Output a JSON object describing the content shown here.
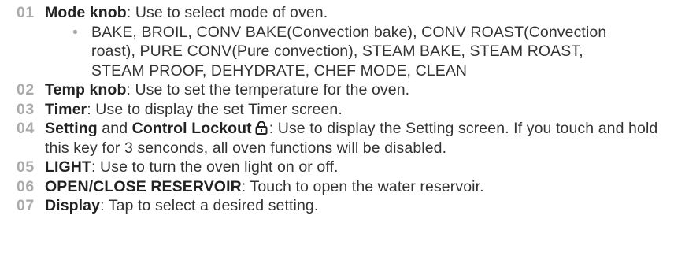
{
  "items": [
    {
      "num": "01",
      "label": "Mode knob",
      "text": ": Use to select mode of oven.",
      "sub_bullet": "•",
      "sub": "BAKE, BROIL, CONV BAKE(Convection bake), CONV ROAST(Convection roast), PURE CONV(Pure convection), STEAM BAKE, STEAM ROAST, STEAM PROOF, DEHYDRATE, CHEF MODE, CLEAN"
    },
    {
      "num": "02",
      "label": "Temp knob",
      "text": ": Use to set the temperature for the oven."
    },
    {
      "num": "03",
      "label": "Timer",
      "text": ": Use to display the set Timer screen."
    },
    {
      "num": "04",
      "label": "Setting",
      "joiner": " and ",
      "label2": "Control Lockout",
      "icon": "padlock-icon",
      "text": ": Use to display the Setting screen. If you touch and hold this key for 3 senconds, all oven functions will be disabled."
    },
    {
      "num": "05",
      "label": "LIGHT",
      "text": ": Use to turn the oven light on or off."
    },
    {
      "num": "06",
      "label": "OPEN/CLOSE RESERVOIR",
      "text": ": Touch to open the water reservoir."
    },
    {
      "num": "07",
      "label": "Display",
      "text": ": Tap to select a desired setting."
    }
  ]
}
